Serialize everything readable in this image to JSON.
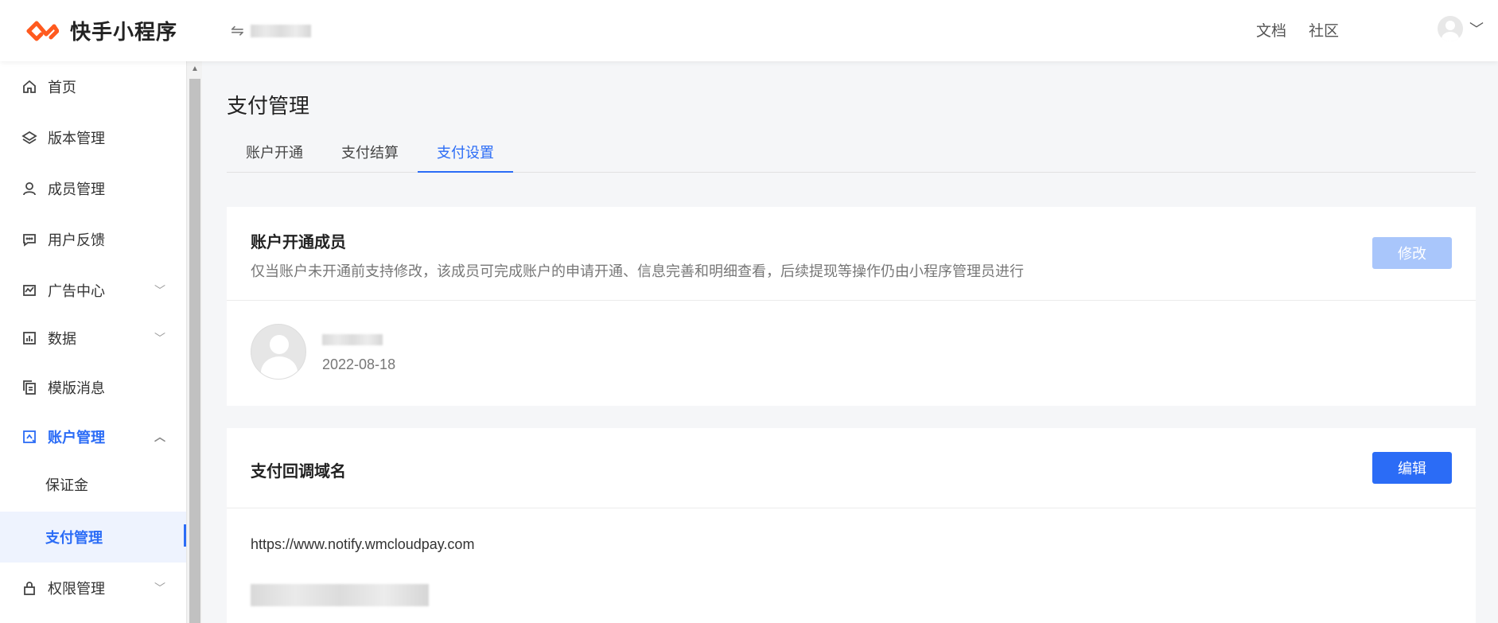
{
  "app": {
    "name": "快手小程序"
  },
  "header": {
    "switch_icon": "⇋",
    "links": [
      "文档",
      "社区"
    ],
    "user_chevron": "﹀"
  },
  "sidebar": {
    "items": [
      {
        "label": "首页",
        "icon": "home-icon"
      },
      {
        "label": "版本管理",
        "icon": "layers-icon"
      },
      {
        "label": "成员管理",
        "icon": "user-icon"
      },
      {
        "label": "用户反馈",
        "icon": "message-icon"
      },
      {
        "label": "广告中心",
        "icon": "chart-icon",
        "arrow": "﹀"
      },
      {
        "label": "数据",
        "icon": "bar-chart-icon",
        "arrow": "﹀"
      },
      {
        "label": "模版消息",
        "icon": "copy-icon"
      },
      {
        "label": "账户管理",
        "icon": "account-icon",
        "arrow": "︿"
      },
      {
        "label": "权限管理",
        "icon": "lock-icon",
        "arrow": "﹀"
      }
    ],
    "sub_items": [
      "保证金",
      "支付管理"
    ]
  },
  "main": {
    "page_title": "支付管理",
    "tabs": [
      "账户开通",
      "支付结算",
      "支付设置"
    ],
    "active_tab": "支付设置",
    "member_card": {
      "title": "账户开通成员",
      "description": "仅当账户未开通前支持修改，该成员可完成账户的申请开通、信息完善和明细查看，后续提现等操作仍由小程序管理员进行",
      "modify_button": "修改",
      "member_date": "2022-08-18"
    },
    "domain_card": {
      "title": "支付回调域名",
      "edit_button": "编辑",
      "domain": "https://www.notify.wmcloudpay.com"
    }
  },
  "colors": {
    "accent": "#2b6cf6",
    "logo": "#ff5a1f",
    "disabled_button": "#a9c6fb"
  }
}
